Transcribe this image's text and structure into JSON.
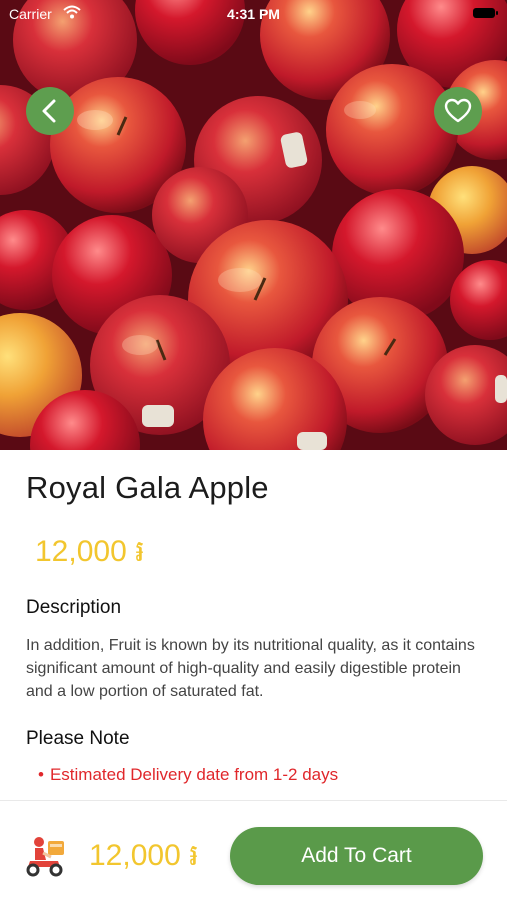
{
  "status_bar": {
    "carrier": "Carrier",
    "time": "4:31 PM"
  },
  "product": {
    "name": "Royal Gala Apple",
    "price": "12,000 ៛"
  },
  "description": {
    "heading": "Description",
    "text": "In addition, Fruit is known by its nutritional quality, as it contains significant amount of high-quality and easily digestible protein and a low portion of saturated fat."
  },
  "note": {
    "heading": "Please Note",
    "items": [
      "Estimated Delivery date from 1-2 days"
    ],
    "bullet": "•"
  },
  "bottom_bar": {
    "price": "12,000 ៛",
    "add_to_cart_label": "Add To Cart"
  },
  "colors": {
    "accent_green": "#5a9a4a",
    "price_yellow": "#f2c62e",
    "note_red": "#e0272b"
  },
  "icons": [
    "back-arrow-icon",
    "heart-icon",
    "delivery-rider-icon",
    "wifi-icon",
    "battery-icon"
  ]
}
